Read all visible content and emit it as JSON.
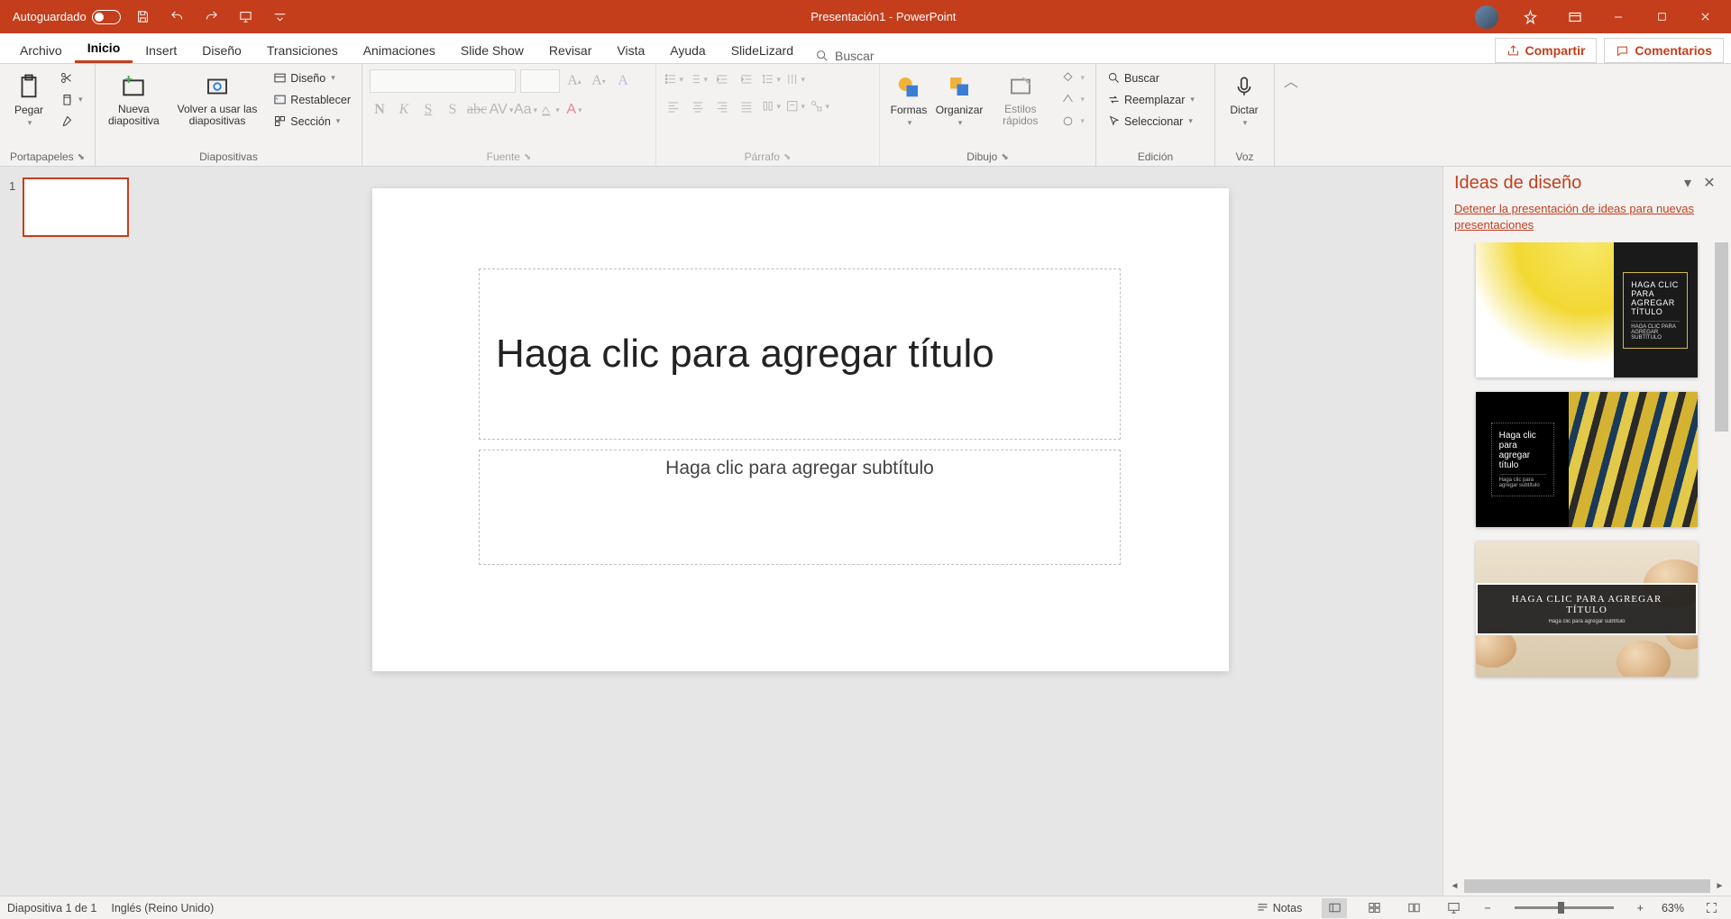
{
  "titlebar": {
    "autosave_label": "Autoguardado",
    "title": "Presentación1  -  PowerPoint"
  },
  "tabs": {
    "items": [
      "Archivo",
      "Inicio",
      "Insert",
      "Diseño",
      "Transiciones",
      "Animaciones",
      "Slide Show",
      "Revisar",
      "Vista",
      "Ayuda",
      "SlideLizard"
    ],
    "active_index": 1,
    "search": "Buscar",
    "share": "Compartir",
    "comments": "Comentarios"
  },
  "ribbon": {
    "clipboard": {
      "paste": "Pegar",
      "label": "Portapapeles"
    },
    "slides": {
      "new_slide": "Nueva diapositiva",
      "reuse": "Volver a usar las diapositivas",
      "layout": "Diseño",
      "reset": "Restablecer",
      "section": "Sección",
      "label": "Diapositivas"
    },
    "font": {
      "label": "Fuente",
      "bold": "N",
      "italic": "K",
      "underline": "S",
      "shadow": "S",
      "strike": "abc",
      "spacing": "AV",
      "case": "Aa"
    },
    "paragraph": {
      "label": "Párrafo"
    },
    "drawing": {
      "shapes": "Formas",
      "arrange": "Organizar",
      "qstyles": "Estilos rápidos",
      "label": "Dibujo"
    },
    "editing": {
      "find": "Buscar",
      "replace": "Reemplazar",
      "select": "Seleccionar",
      "label": "Edición"
    },
    "voice": {
      "dictate": "Dictar",
      "label": "Voz"
    }
  },
  "thumbnails": {
    "slides": [
      {
        "num": "1"
      }
    ]
  },
  "slide": {
    "title_placeholder": "Haga clic para agregar título",
    "subtitle_placeholder": "Haga clic para agregar subtítulo"
  },
  "pane": {
    "title": "Ideas de diseño",
    "stop_link": "Detener la presentación de ideas para nuevas presentaciones",
    "card_title_upper": "HAGA CLIC PARA AGREGAR TÍTULO",
    "card_sub_upper": "HAGA CLIC PARA AGREGAR SUBTÍTULO",
    "card_title": "Haga clic para agregar título",
    "card_sub": "Haga clic para agregar subtítulo"
  },
  "statusbar": {
    "slide_info": "Diapositiva 1 de 1",
    "language": "Inglés (Reino Unido)",
    "notes": "Notas",
    "zoom": "63%"
  }
}
